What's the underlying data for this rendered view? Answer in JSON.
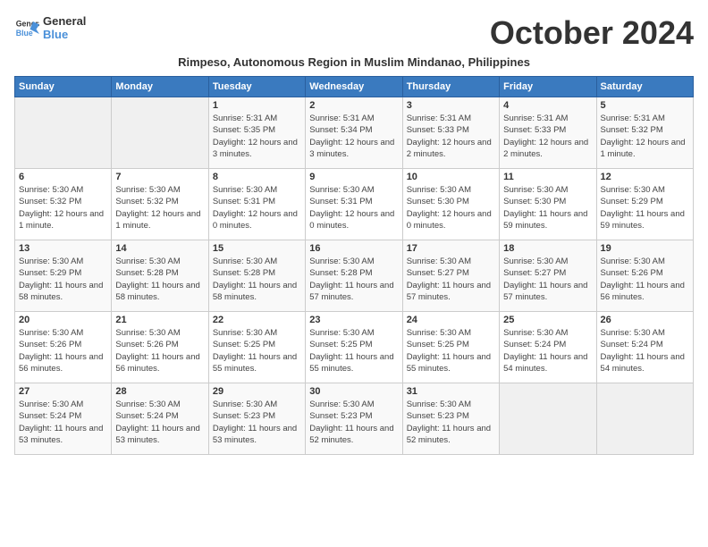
{
  "logo": {
    "line1": "General",
    "line2": "Blue"
  },
  "title": "October 2024",
  "subtitle": "Rimpeso, Autonomous Region in Muslim Mindanao, Philippines",
  "weekdays": [
    "Sunday",
    "Monday",
    "Tuesday",
    "Wednesday",
    "Thursday",
    "Friday",
    "Saturday"
  ],
  "weeks": [
    [
      {
        "day": "",
        "info": ""
      },
      {
        "day": "",
        "info": ""
      },
      {
        "day": "1",
        "info": "Sunrise: 5:31 AM\nSunset: 5:35 PM\nDaylight: 12 hours and 3 minutes."
      },
      {
        "day": "2",
        "info": "Sunrise: 5:31 AM\nSunset: 5:34 PM\nDaylight: 12 hours and 3 minutes."
      },
      {
        "day": "3",
        "info": "Sunrise: 5:31 AM\nSunset: 5:33 PM\nDaylight: 12 hours and 2 minutes."
      },
      {
        "day": "4",
        "info": "Sunrise: 5:31 AM\nSunset: 5:33 PM\nDaylight: 12 hours and 2 minutes."
      },
      {
        "day": "5",
        "info": "Sunrise: 5:31 AM\nSunset: 5:32 PM\nDaylight: 12 hours and 1 minute."
      }
    ],
    [
      {
        "day": "6",
        "info": "Sunrise: 5:30 AM\nSunset: 5:32 PM\nDaylight: 12 hours and 1 minute."
      },
      {
        "day": "7",
        "info": "Sunrise: 5:30 AM\nSunset: 5:32 PM\nDaylight: 12 hours and 1 minute."
      },
      {
        "day": "8",
        "info": "Sunrise: 5:30 AM\nSunset: 5:31 PM\nDaylight: 12 hours and 0 minutes."
      },
      {
        "day": "9",
        "info": "Sunrise: 5:30 AM\nSunset: 5:31 PM\nDaylight: 12 hours and 0 minutes."
      },
      {
        "day": "10",
        "info": "Sunrise: 5:30 AM\nSunset: 5:30 PM\nDaylight: 12 hours and 0 minutes."
      },
      {
        "day": "11",
        "info": "Sunrise: 5:30 AM\nSunset: 5:30 PM\nDaylight: 11 hours and 59 minutes."
      },
      {
        "day": "12",
        "info": "Sunrise: 5:30 AM\nSunset: 5:29 PM\nDaylight: 11 hours and 59 minutes."
      }
    ],
    [
      {
        "day": "13",
        "info": "Sunrise: 5:30 AM\nSunset: 5:29 PM\nDaylight: 11 hours and 58 minutes."
      },
      {
        "day": "14",
        "info": "Sunrise: 5:30 AM\nSunset: 5:28 PM\nDaylight: 11 hours and 58 minutes."
      },
      {
        "day": "15",
        "info": "Sunrise: 5:30 AM\nSunset: 5:28 PM\nDaylight: 11 hours and 58 minutes."
      },
      {
        "day": "16",
        "info": "Sunrise: 5:30 AM\nSunset: 5:28 PM\nDaylight: 11 hours and 57 minutes."
      },
      {
        "day": "17",
        "info": "Sunrise: 5:30 AM\nSunset: 5:27 PM\nDaylight: 11 hours and 57 minutes."
      },
      {
        "day": "18",
        "info": "Sunrise: 5:30 AM\nSunset: 5:27 PM\nDaylight: 11 hours and 57 minutes."
      },
      {
        "day": "19",
        "info": "Sunrise: 5:30 AM\nSunset: 5:26 PM\nDaylight: 11 hours and 56 minutes."
      }
    ],
    [
      {
        "day": "20",
        "info": "Sunrise: 5:30 AM\nSunset: 5:26 PM\nDaylight: 11 hours and 56 minutes."
      },
      {
        "day": "21",
        "info": "Sunrise: 5:30 AM\nSunset: 5:26 PM\nDaylight: 11 hours and 56 minutes."
      },
      {
        "day": "22",
        "info": "Sunrise: 5:30 AM\nSunset: 5:25 PM\nDaylight: 11 hours and 55 minutes."
      },
      {
        "day": "23",
        "info": "Sunrise: 5:30 AM\nSunset: 5:25 PM\nDaylight: 11 hours and 55 minutes."
      },
      {
        "day": "24",
        "info": "Sunrise: 5:30 AM\nSunset: 5:25 PM\nDaylight: 11 hours and 55 minutes."
      },
      {
        "day": "25",
        "info": "Sunrise: 5:30 AM\nSunset: 5:24 PM\nDaylight: 11 hours and 54 minutes."
      },
      {
        "day": "26",
        "info": "Sunrise: 5:30 AM\nSunset: 5:24 PM\nDaylight: 11 hours and 54 minutes."
      }
    ],
    [
      {
        "day": "27",
        "info": "Sunrise: 5:30 AM\nSunset: 5:24 PM\nDaylight: 11 hours and 53 minutes."
      },
      {
        "day": "28",
        "info": "Sunrise: 5:30 AM\nSunset: 5:24 PM\nDaylight: 11 hours and 53 minutes."
      },
      {
        "day": "29",
        "info": "Sunrise: 5:30 AM\nSunset: 5:23 PM\nDaylight: 11 hours and 53 minutes."
      },
      {
        "day": "30",
        "info": "Sunrise: 5:30 AM\nSunset: 5:23 PM\nDaylight: 11 hours and 52 minutes."
      },
      {
        "day": "31",
        "info": "Sunrise: 5:30 AM\nSunset: 5:23 PM\nDaylight: 11 hours and 52 minutes."
      },
      {
        "day": "",
        "info": ""
      },
      {
        "day": "",
        "info": ""
      }
    ]
  ]
}
